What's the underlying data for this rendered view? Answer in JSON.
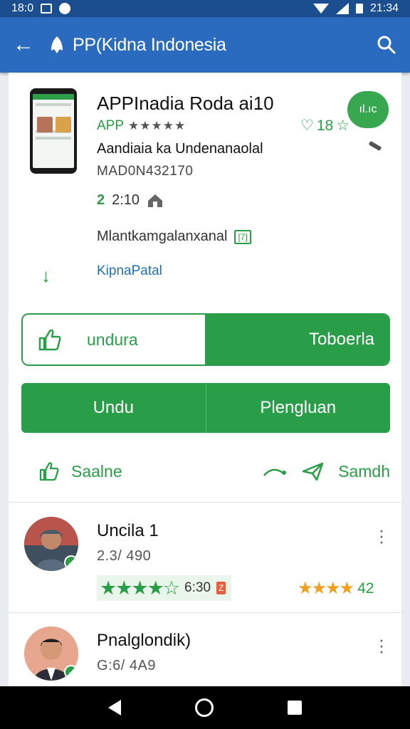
{
  "status_bar": {
    "time": "18:0",
    "clock": "21:34"
  },
  "app_bar": {
    "title": "PP(Kidna Indonesia"
  },
  "app": {
    "name": "APPInadia Roda ai10",
    "type_label": "APP",
    "stars": "★★★★★",
    "rating_label": "18",
    "badge_label": "ıl.ıc",
    "developer": "Aandiaia ka Undenanaolal",
    "code": "MAD0N432170",
    "meta_value": "2",
    "meta_text": "2:10",
    "category": "Mlantkamgalanxanal",
    "category_badge": "[7]",
    "link_text": "KipnaPatal"
  },
  "buttons": {
    "like_label": "undura",
    "right_label": "Toboerla",
    "install_label": "Undu",
    "secondary_label": "Plengluan",
    "share_label": "Saalne",
    "send_label": "Samdh"
  },
  "reviews": [
    {
      "name": "Uncila 1",
      "date": "2.3/ 490",
      "rating_value": "6:30",
      "rating_badge": "Z",
      "right_stars": "★★★★",
      "right_value": "42"
    },
    {
      "name": "Pnalglondik)",
      "date": "G:6/ 4A9"
    }
  ],
  "colors": {
    "status_bar": "#1b4e8f",
    "app_bar": "#2a6bbf",
    "accent_green": "#2a9d48",
    "star_orange": "#f0a020"
  },
  "icons": [
    "back-arrow-icon",
    "app-logo-icon",
    "search-icon",
    "thumbs-up-icon",
    "share-icon",
    "send-icon",
    "more-vert-icon",
    "home-icon",
    "download-arrow-icon",
    "verified-check-icon"
  ]
}
